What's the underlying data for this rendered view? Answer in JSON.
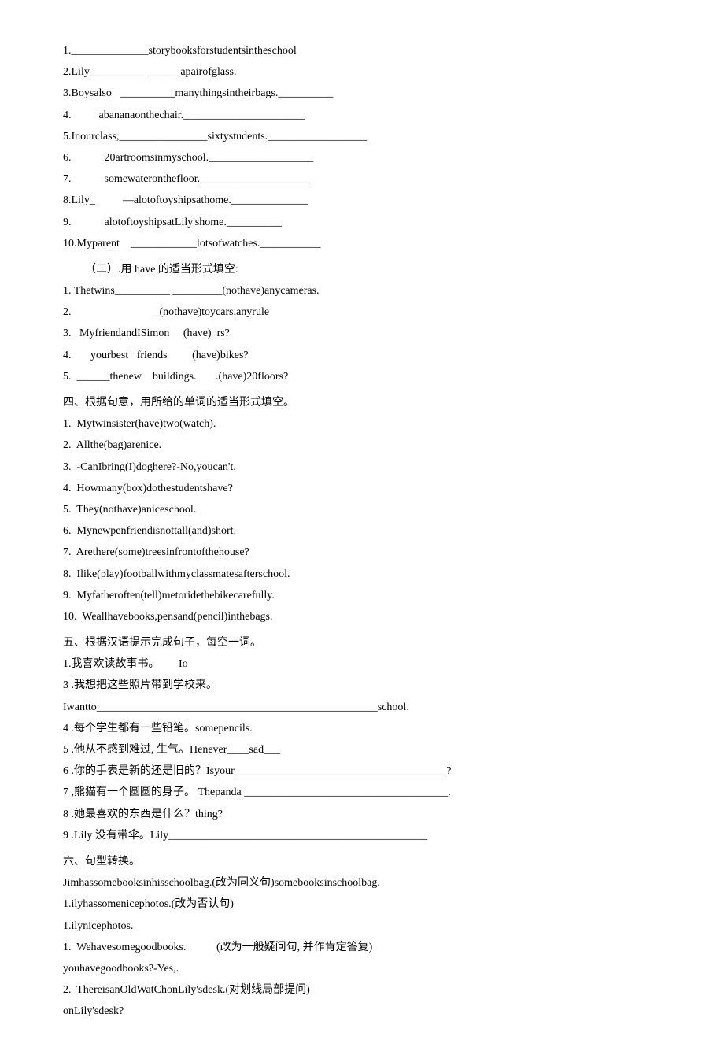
{
  "sec1": {
    "items": [
      "1.______________storybooksforstudentsintheschool",
      "2.Lily__________ ______apairofglass.",
      "3.Boysalso   __________manythingsintheirbags.__________",
      "4.          abananaonthechair.______________________",
      "5.Inourclass,________________sixtystudents.__________________",
      "6.            20artroomsinmyschool.___________________",
      "7.            somewateronthefloor.____________________",
      "8.Lily_          —alotoftoyshipsathome.______________",
      "9.            alotoftoyshipsatLily'shome.__________",
      "10.Myparent    ____________lotsofwatches.___________"
    ]
  },
  "sec2": {
    "title": "（二）.用 have 的适当形式填空:",
    "items": [
      "1. Thetwins__________ _________(nothave)anycameras.",
      "2.                              _(nothave)toycars,anyrule",
      "3.   MyfriendandISimon     (have)  rs?",
      "4.       yourbest   friends         (have)bikes?",
      "5.  ______thenew    buildings.       .(have)20floors?"
    ]
  },
  "sec4": {
    "title": "四、根据句意，用所给的单词的适当形式填空。",
    "items": [
      "1.  Mytwinsister(have)two(watch).",
      "2.  Allthe(bag)arenice.",
      "3.  -CanIbring(I)doghere?-No,youcan't.",
      "4.  Howmany(box)dothestudentshave?",
      "5.  They(nothave)aniceschool.",
      "6.  Mynewpenfriendisnottall(and)short.",
      "7.  Arethere(some)treesinfrontofthehouse?",
      "8.  Ilike(play)footballwithmyclassmatesafterschool.",
      "9.  Myfatheroften(tell)metoridethebikecarefully.",
      "10.  Weallhavebooks,pensand(pencil)inthebags."
    ]
  },
  "sec5": {
    "title": "五、根据汉语提示完成句子，每空一词。",
    "items": [
      "1.我喜欢读故事书。       Io",
      "3 .我想把这些照片带到学校来。",
      "Iwantto___________________________________________________school.",
      "4 .每个学生都有一些铅笔。somepencils.",
      "5 .他从不感到难过, 生气。Henever____sad___",
      "6 .你的手表是新的还是旧的？Isyour ______________________________________?",
      "7 ,熊猫有一个圆圆的身子。 Thepanda _____________________________________.",
      "8 .她最喜欢的东西是什么？thing?",
      "9 .Lily 没有带伞。Lily_______________________________________________"
    ]
  },
  "sec6": {
    "title": "六、句型转换。",
    "items": [
      "Jimhassomebooksinhisschoolbag.(改为同义句)somebooksinschoolbag.",
      "1.ilyhassomenicephotos.(改为否认句)",
      "1.ilynicephotos.",
      "1.  Wehavesomegoodbooks.           (改为一般疑问句, 并作肯定答复)",
      "youhavegoodbooks?-Yes,.",
      "2.  Thereis",
      "onLily'sdesk.(对划线局部提问)",
      "onLily'sdesk?"
    ],
    "underlined": "anOldWatCh"
  }
}
